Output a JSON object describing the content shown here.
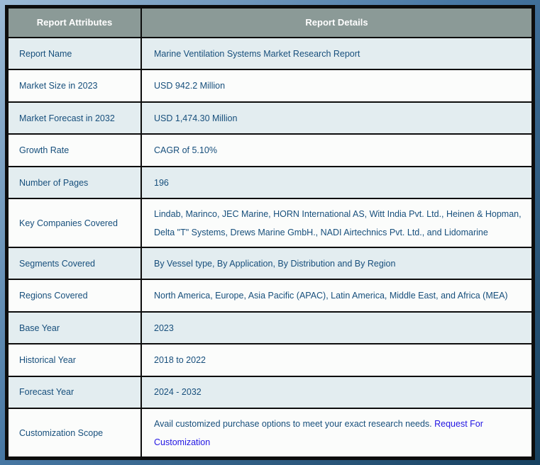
{
  "theme": {
    "frame_light": "#9dbbd6",
    "frame_mid": "#4878a4",
    "frame_dark": "#16405f",
    "border_color": "#0d0d0d",
    "header_bg": "#8b9a97",
    "header_text": "#ffffff",
    "row_odd": "#e3edf0",
    "row_even": "#fbfcfb",
    "cell_text": "#174f7c",
    "link_color": "#2215e3"
  },
  "table": {
    "header": {
      "attributes": "Report Attributes",
      "details": "Report Details"
    },
    "rows": [
      {
        "label": "Report Name",
        "value": "Marine Ventilation Systems Market Research Report"
      },
      {
        "label": "Market Size in 2023",
        "value": "USD 942.2 Million"
      },
      {
        "label": "Market Forecast in 2032",
        "value": "USD 1,474.30 Million"
      },
      {
        "label": "Growth Rate",
        "value": "CAGR of 5.10%"
      },
      {
        "label": "Number of Pages",
        "value": "196"
      },
      {
        "label": "Key Companies Covered",
        "value": "Lindab, Marinco, JEC Marine, HORN International AS, Witt India Pvt. Ltd., Heinen & Hopman, Delta \"T\" Systems, Drews Marine GmbH., NADI Airtechnics Pvt. Ltd., and Lidomarine",
        "tall": true
      },
      {
        "label": "Segments Covered",
        "value": "By Vessel type, By Application, By Distribution and By Region"
      },
      {
        "label": "Regions Covered",
        "value": "North America, Europe, Asia Pacific (APAC), Latin America, Middle East, and Africa (MEA)"
      },
      {
        "label": "Base Year",
        "value": "2023"
      },
      {
        "label": "Historical Year",
        "value": "2018 to 2022"
      },
      {
        "label": "Forecast Year",
        "value": "2024 - 2032"
      },
      {
        "label": "Customization Scope",
        "value": "Avail customized purchase options to meet your exact research needs. ",
        "link": "Request For Customization",
        "tall": true
      }
    ]
  }
}
